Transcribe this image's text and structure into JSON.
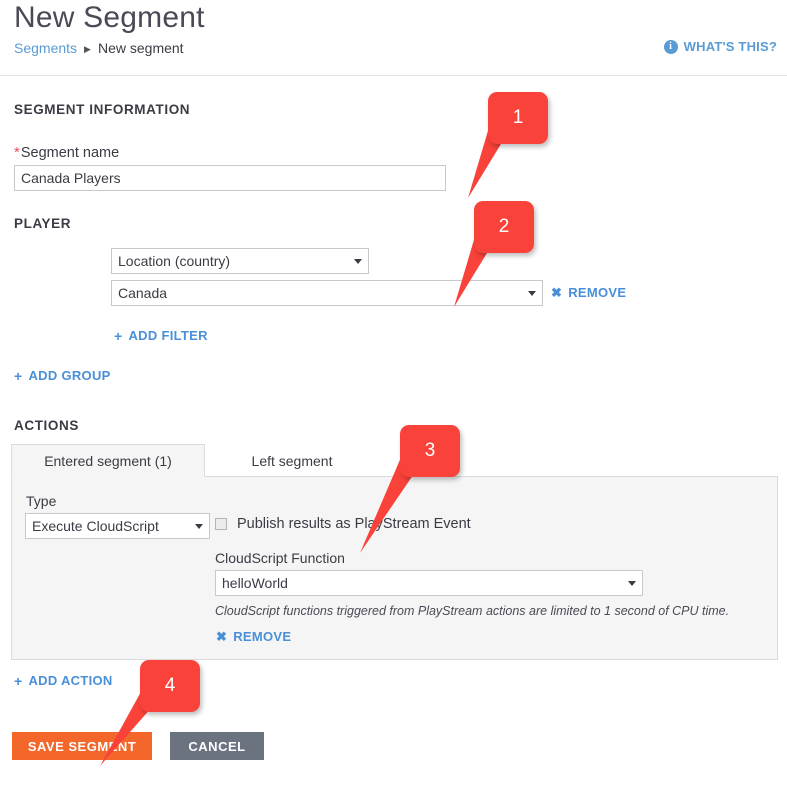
{
  "header": {
    "title": "New Segment",
    "breadcrumb": {
      "parent": "Segments",
      "separator": "▶",
      "current": "New segment"
    },
    "help_link": {
      "label": "WHAT'S THIS?",
      "icon": "info-icon",
      "icon_glyph": "i"
    }
  },
  "sections": {
    "segment_information": {
      "heading": "SEGMENT INFORMATION",
      "name_field": {
        "required_marker": "*",
        "label": "Segment name",
        "value": "Canada Players",
        "placeholder": "Segment name"
      }
    },
    "player": {
      "heading": "PLAYER",
      "filter": {
        "field_select": {
          "value": "Location (country)",
          "options": [
            "Location (country)"
          ]
        },
        "value_select": {
          "value": "Canada",
          "options": [
            "Canada"
          ]
        },
        "remove_label": "REMOVE",
        "remove_icon_glyph": "✖"
      },
      "add_filter_label": "ADD FILTER",
      "add_filter_icon_glyph": "+"
    },
    "add_group": {
      "label": "ADD GROUP",
      "icon_glyph": "+"
    },
    "actions": {
      "heading": "ACTIONS",
      "tabs": [
        {
          "label": "Entered segment (1)",
          "active": true
        },
        {
          "label": "Left segment",
          "active": false
        }
      ],
      "panel": {
        "type_label": "Type",
        "type_select": {
          "value": "Execute CloudScript",
          "options": [
            "Execute CloudScript"
          ]
        },
        "publish_checkbox": {
          "label": "Publish results as PlayStream Event",
          "checked": false
        },
        "function_label": "CloudScript Function",
        "function_select": {
          "value": "helloWorld",
          "options": [
            "helloWorld"
          ]
        },
        "help_text": "CloudScript functions triggered from PlayStream actions are limited to 1 second of CPU time.",
        "remove_label": "REMOVE",
        "remove_icon_glyph": "✖"
      },
      "add_action_label": "ADD ACTION",
      "add_action_icon_glyph": "+"
    }
  },
  "footer": {
    "save_label": "SAVE SEGMENT",
    "cancel_label": "CANCEL"
  },
  "callouts": [
    {
      "number": "1"
    },
    {
      "number": "2"
    },
    {
      "number": "3"
    },
    {
      "number": "4"
    }
  ],
  "colors": {
    "accent_blue": "#4a90d9",
    "link_blue": "#5b9bd5",
    "required_red": "#ef4b5e",
    "callout_red": "#f9423a",
    "save_orange": "#f4672a",
    "cancel_gray": "#6b7280",
    "panel_gray": "#f5f5f5"
  }
}
